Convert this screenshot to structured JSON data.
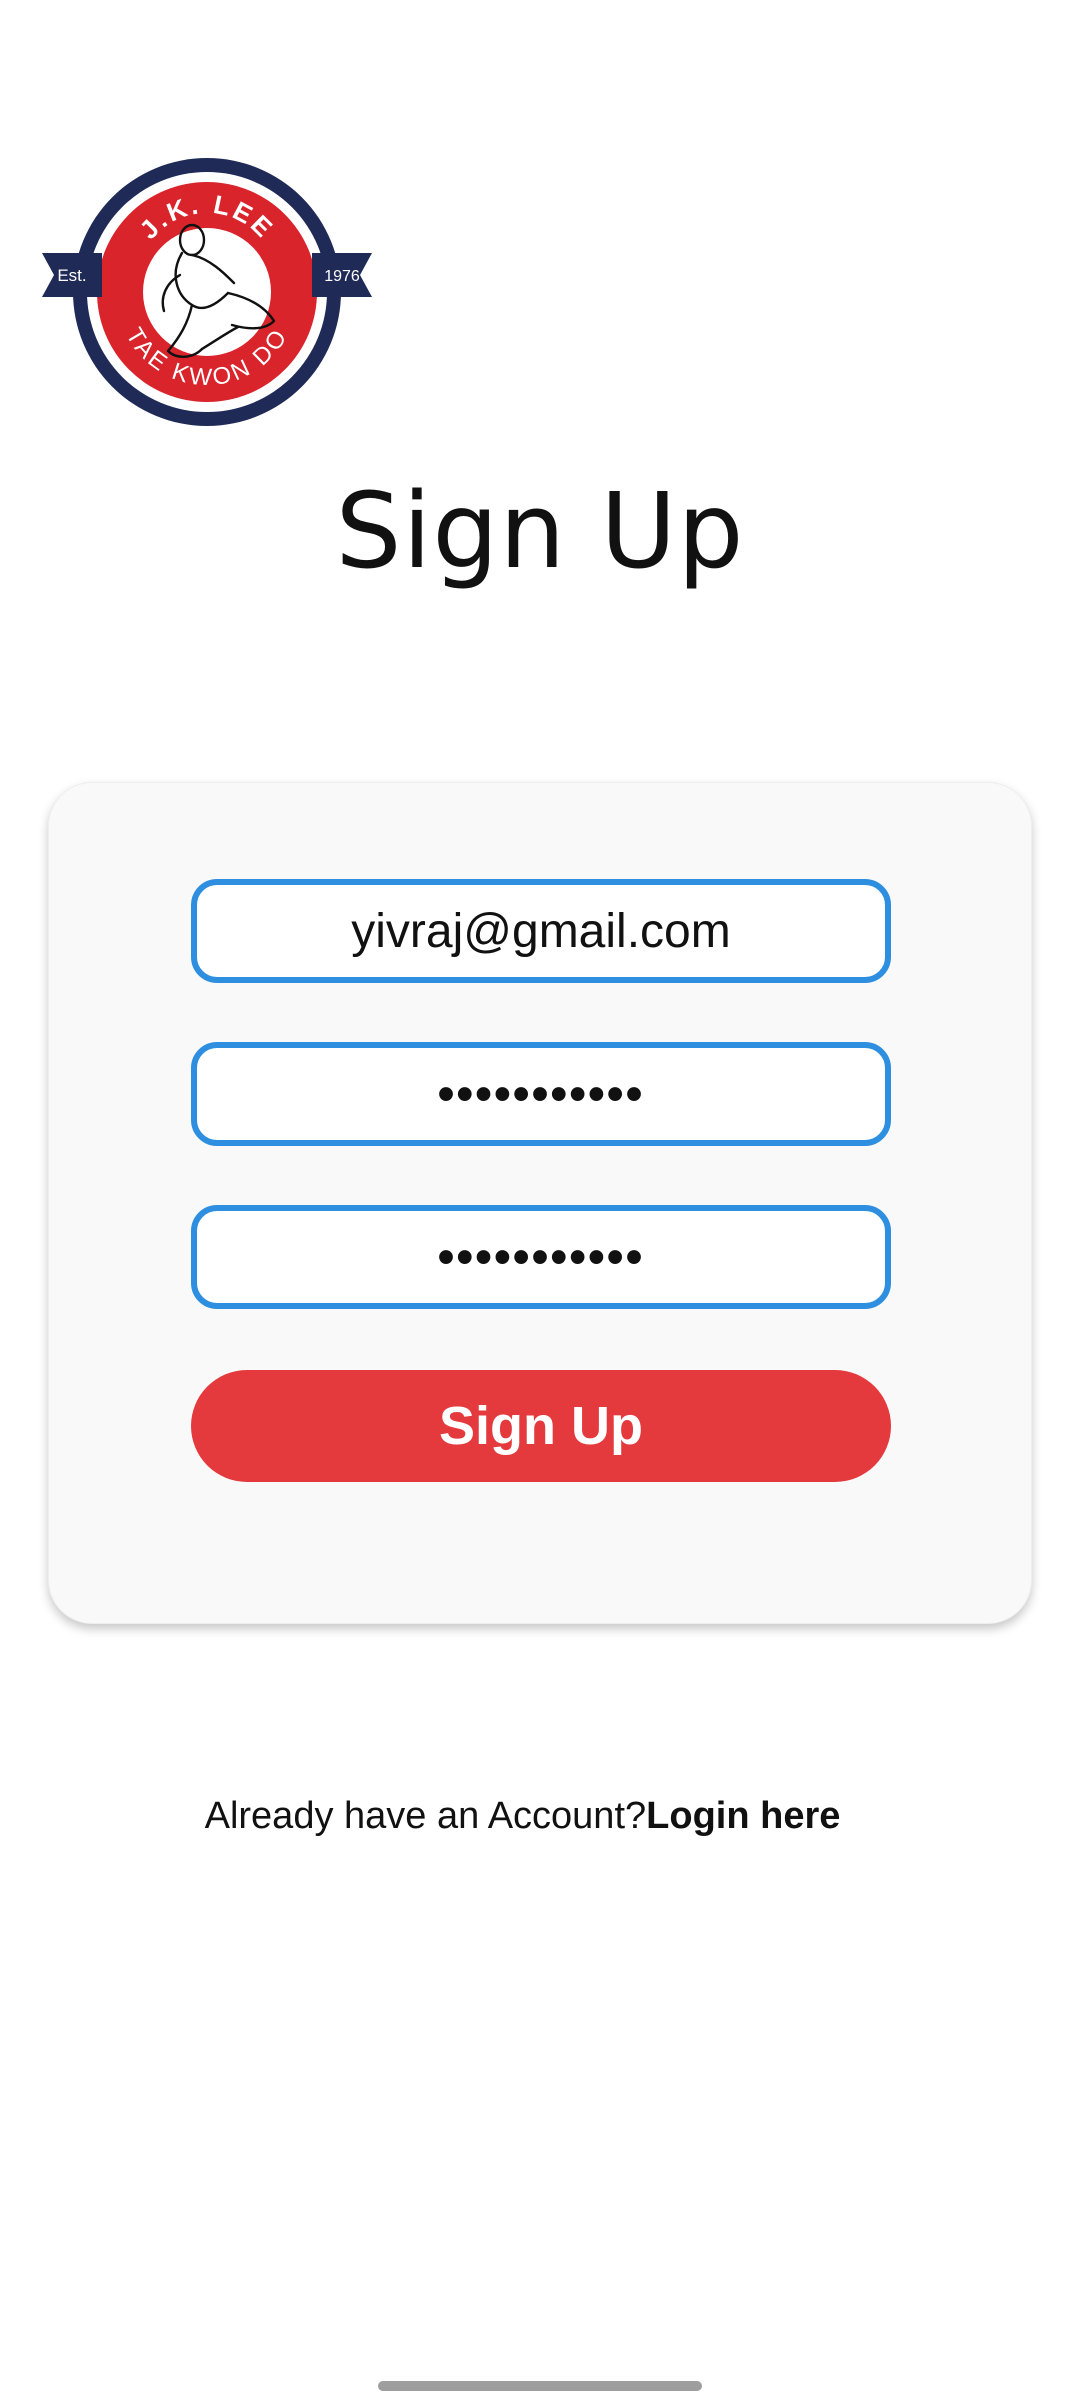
{
  "logo": {
    "top_text": "J.K. LEE",
    "bottom_text": "TAE KWON DO",
    "left_banner": "Est.",
    "right_banner": "1976",
    "colors": {
      "navy": "#1f2a57",
      "red": "#d9242c",
      "white": "#ffffff"
    }
  },
  "page": {
    "title": "Sign Up"
  },
  "form": {
    "email_value": "yivraj@gmail.com",
    "password_mask": "•••••••••••",
    "confirm_password_mask": "•••••••••••",
    "submit_label": "Sign Up"
  },
  "footer": {
    "prompt": "Already have an Account?",
    "login_link": "Login here"
  },
  "colors": {
    "field_border": "#2e8fe0",
    "button_bg": "#e53a3d",
    "card_bg": "#f9f9f9"
  }
}
